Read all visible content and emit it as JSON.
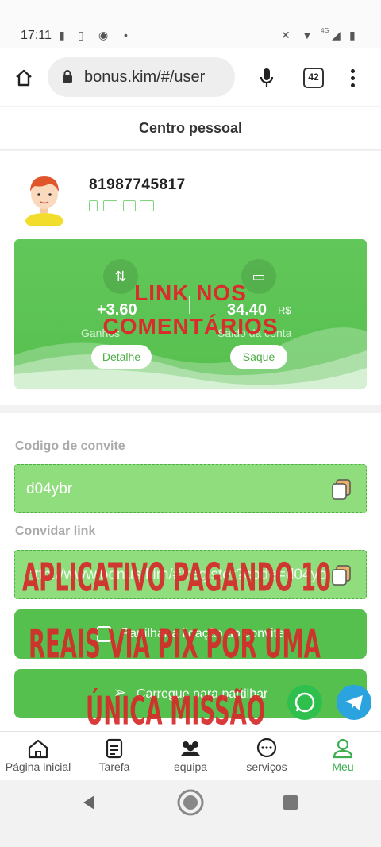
{
  "status_bar": {
    "time": "17:11",
    "network": "4G"
  },
  "browser": {
    "url": "bonus.kim/#/user",
    "tabs_count": "42"
  },
  "header": {
    "title": "Centro pessoal"
  },
  "profile": {
    "phone": "81987745817",
    "card": {
      "left_value": "+3.60",
      "left_label": "Ganhos",
      "right_value": "34.40",
      "right_currency": "R$",
      "right_label": "Saldo da conta",
      "detail_button": "Detalhe",
      "withdraw_button": "Saque",
      "overlay_line1": "LINK NOS",
      "overlay_line2": "COMENTÁRIOS"
    }
  },
  "invite": {
    "code_label": "Codigo de convite",
    "code_value": "d04ybr",
    "link_label": "Convidar link",
    "link_value": "http://www.bonus.kim/#/register?code=d04ybr",
    "share_button": "Partilhar a ligação do convite",
    "upload_button": "Carregue para partilhar",
    "overlay_line1": "APLICATIVO PAGANDO 10",
    "overlay_line2": "REAIS VIA PIX POR UMA",
    "overlay_line3": "ÚNICA MISSÃO"
  },
  "bottom_nav": {
    "items": [
      {
        "label": "Página inicial",
        "icon": "home-icon"
      },
      {
        "label": "Tarefa",
        "icon": "document-icon"
      },
      {
        "label": "equipa",
        "icon": "group-icon"
      },
      {
        "label": "serviços",
        "icon": "chat-icon"
      },
      {
        "label": "Meu",
        "icon": "user-icon",
        "active": true
      }
    ]
  },
  "colors": {
    "brand_green": "#56c04e",
    "light_green": "#8fdd7c",
    "overlay_red": "#d62a2a",
    "whatsapp": "#2fbf4d",
    "telegram": "#2aa3de"
  }
}
